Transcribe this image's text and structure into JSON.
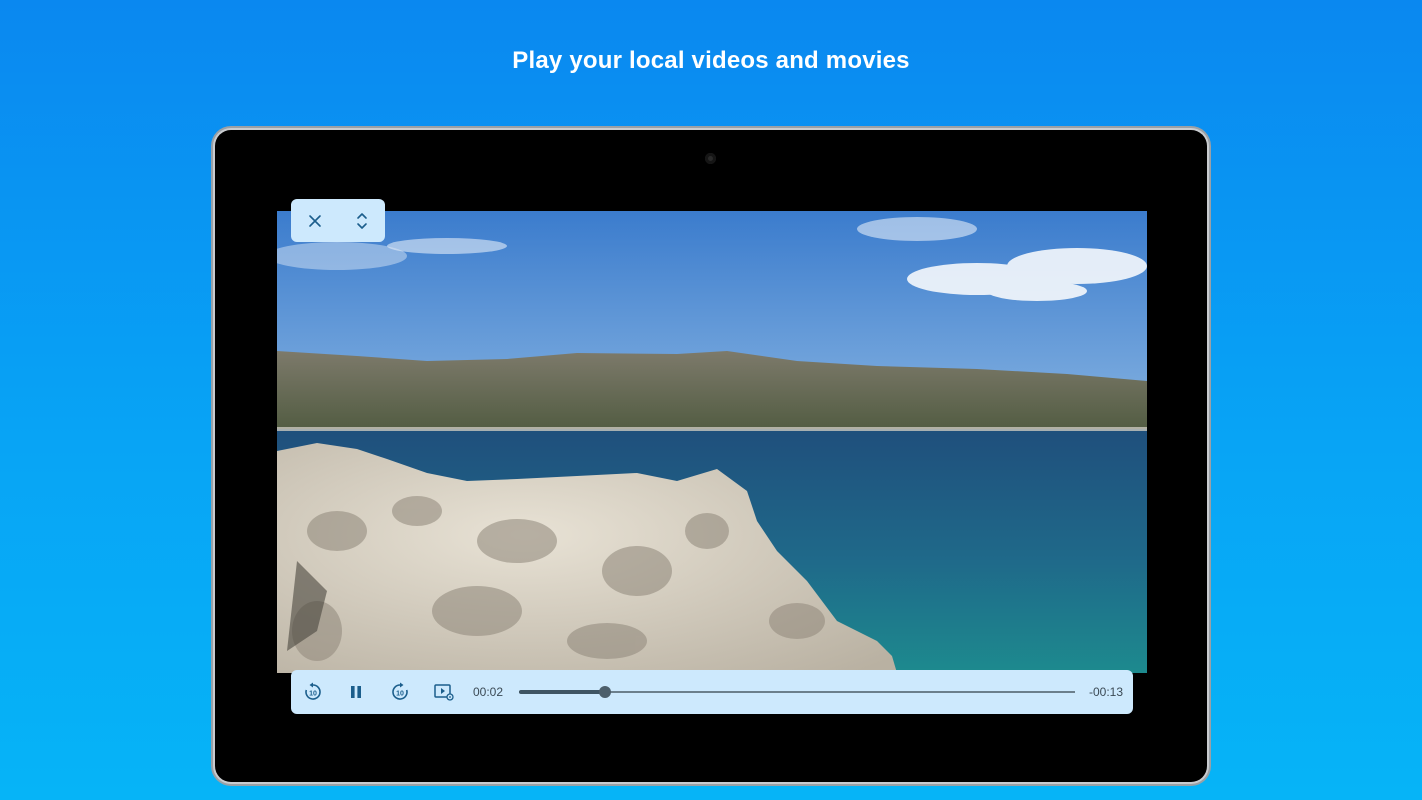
{
  "headline": "Play your local videos and movies",
  "player": {
    "top_controls": {
      "close_icon": "close-icon",
      "expand_icon": "unfold-icon"
    },
    "controls": {
      "rewind_icon": "replay-10-icon",
      "pause_icon": "pause-icon",
      "forward_icon": "forward-10-icon",
      "settings_icon": "video-settings-icon",
      "rewind_seconds": "10",
      "forward_seconds": "10"
    },
    "elapsed": "00:02",
    "remaining": "-00:13",
    "progress_fraction": 0.155
  },
  "colors": {
    "background_top": "#0a88f0",
    "background_bottom": "#06b4f7",
    "control_surface": "#cde9fd",
    "icon": "#1b5e8c"
  }
}
